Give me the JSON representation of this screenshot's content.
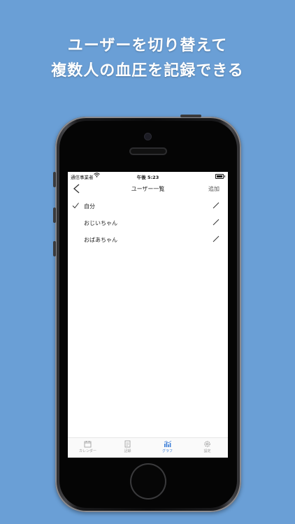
{
  "headline": {
    "line1": "ユーザーを切り替えて",
    "line2": "複数人の血圧を記録できる"
  },
  "status_bar": {
    "carrier": "通信事業者",
    "time": "午後 5:23"
  },
  "nav": {
    "title": "ユーザー一覧",
    "add_label": "追加"
  },
  "users": [
    {
      "name": "自分",
      "selected": true
    },
    {
      "name": "おじいちゃん",
      "selected": false
    },
    {
      "name": "おばあちゃん",
      "selected": false
    }
  ],
  "tabs": [
    {
      "label": "カレンダー",
      "icon": "calendar-icon",
      "active": false
    },
    {
      "label": "記録",
      "icon": "notes-icon",
      "active": false
    },
    {
      "label": "グラフ",
      "icon": "graph-icon",
      "active": true
    },
    {
      "label": "設定",
      "icon": "gear-icon",
      "active": false
    }
  ],
  "colors": {
    "background": "#6a9fd6",
    "active_tab": "#3b7dd8"
  }
}
